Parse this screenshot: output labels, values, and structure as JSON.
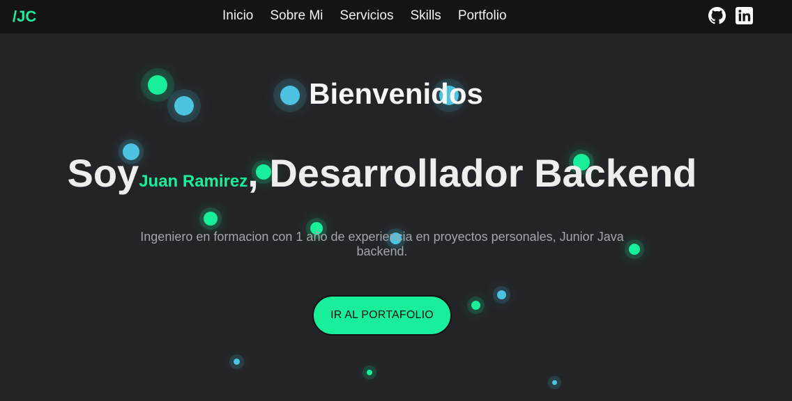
{
  "brand": {
    "logo": "/JC"
  },
  "nav": {
    "links": [
      "Inicio",
      "Sobre Mi",
      "Servicios",
      "Skills",
      "Portfolio"
    ]
  },
  "social": {
    "icons": [
      "github-icon",
      "linkedin-icon"
    ]
  },
  "hero": {
    "welcome": "Bienvenidos",
    "intro": "Soy",
    "name": "Juan Ramirez",
    "role": ", Desarrollador Backend",
    "description": "Ingeniero en formacion con 1 año de experiencia en proyectos personales, Junior Java backend.",
    "cta_label": "IR AL PORTAFOLIO"
  },
  "colors": {
    "accent": "#19ee9a",
    "particle_blue": "#4cc3e0",
    "navbar": "#141414",
    "background": "#232427"
  }
}
